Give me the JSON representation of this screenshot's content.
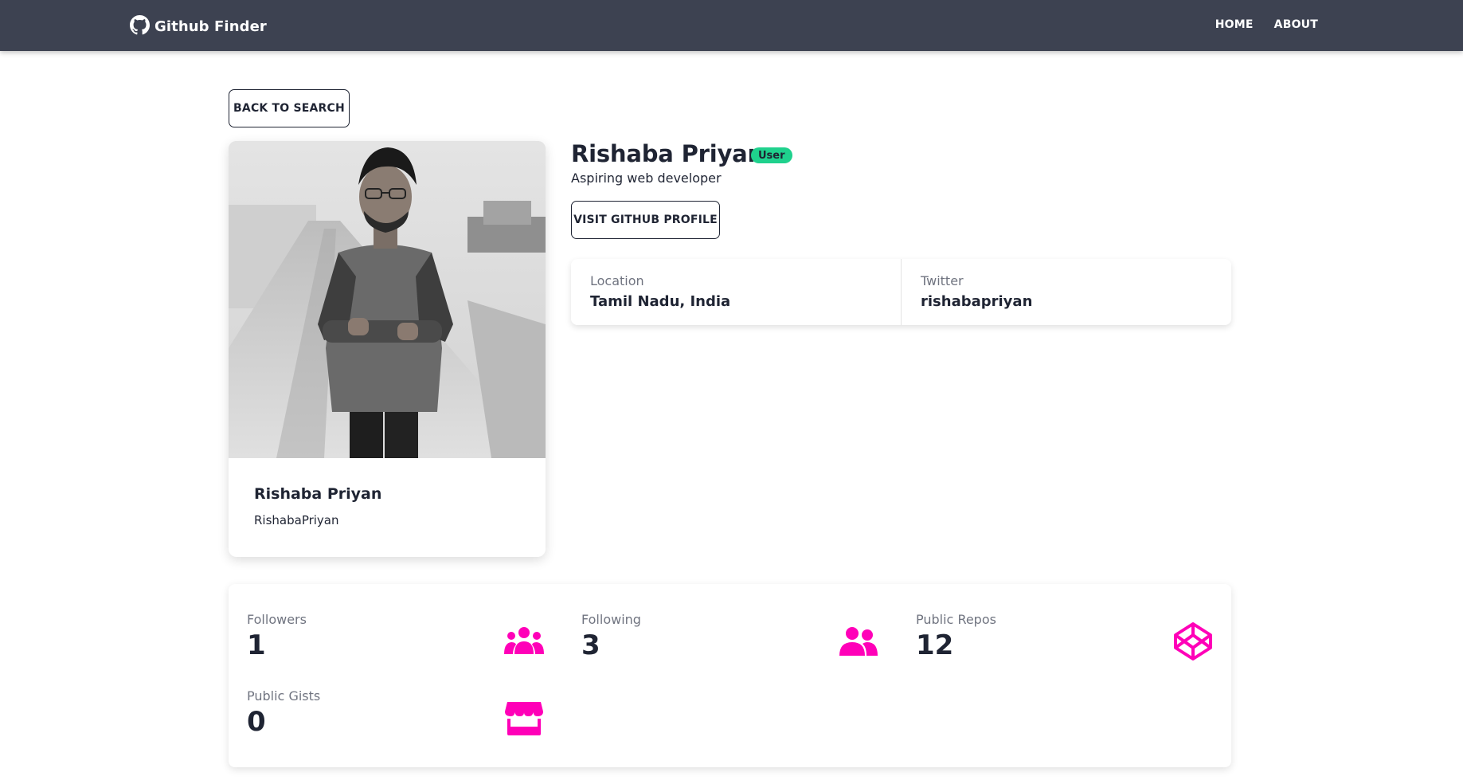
{
  "navbar": {
    "brand": "Github Finder",
    "links": [
      "HOME",
      "ABOUT"
    ]
  },
  "back_button": "BACK TO SEARCH",
  "profile": {
    "name": "Rishaba Priyan",
    "login": "RishabaPriyan",
    "type_badge": "User",
    "bio": "Aspiring web developer",
    "visit_button": "VISIT GITHUB PROFILE"
  },
  "info": {
    "location_label": "Location",
    "location_value": "Tamil Nadu, India",
    "twitter_label": "Twitter",
    "twitter_value": "rishabapriyan"
  },
  "stats": {
    "followers_label": "Followers",
    "followers_value": "1",
    "following_label": "Following",
    "following_value": "3",
    "repos_label": "Public Repos",
    "repos_value": "12",
    "gists_label": "Public Gists",
    "gists_value": "0"
  },
  "colors": {
    "navbar_bg": "#3d4251",
    "badge_bg": "#1fd18d",
    "icon_accent": "#ff00b8",
    "text_dark": "#1f2433"
  },
  "icons": {
    "brand": "github-icon",
    "followers": "users-icon",
    "following": "user-friends-icon",
    "repos": "codepen-icon",
    "gists": "store-icon"
  }
}
